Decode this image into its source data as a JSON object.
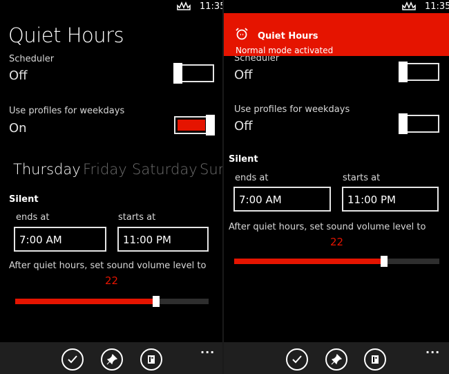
{
  "left": {
    "status": {
      "time": "11:35"
    },
    "title": "Quiet Hours",
    "scheduler": {
      "label": "Scheduler",
      "value": "Off"
    },
    "profiles": {
      "label": "Use profiles for weekdays",
      "value": "On"
    },
    "pivot": [
      "Thursday",
      "Friday",
      "Saturday",
      "Sur"
    ],
    "section": "Silent",
    "ends_label": "ends at",
    "ends_value": "7:00 AM",
    "starts_label": "starts at",
    "starts_value": "11:00 PM",
    "volume_label": "After quiet hours, set sound volume level to",
    "volume_value": "22",
    "volume_fraction": 0.73
  },
  "right": {
    "status": {
      "time": "11:35"
    },
    "toast": {
      "title": "Quiet Hours",
      "message": "Normal mode activated"
    },
    "scheduler": {
      "label": "Scheduler",
      "value": "Off"
    },
    "profiles": {
      "label": "Use profiles for weekdays",
      "value": "Off"
    },
    "section": "Silent",
    "ends_label": "ends at",
    "ends_value": "7:00 AM",
    "starts_label": "starts at",
    "starts_value": "11:00 PM",
    "volume_label": "After quiet hours, set sound volume level to",
    "volume_value": "22",
    "volume_fraction": 0.73
  },
  "appbar": {
    "buttons": [
      "check-icon",
      "pin-icon",
      "book-icon"
    ],
    "more": "..."
  },
  "colors": {
    "accent": "#e51400",
    "background": "#000000",
    "appbar": "#1f1f1f"
  }
}
